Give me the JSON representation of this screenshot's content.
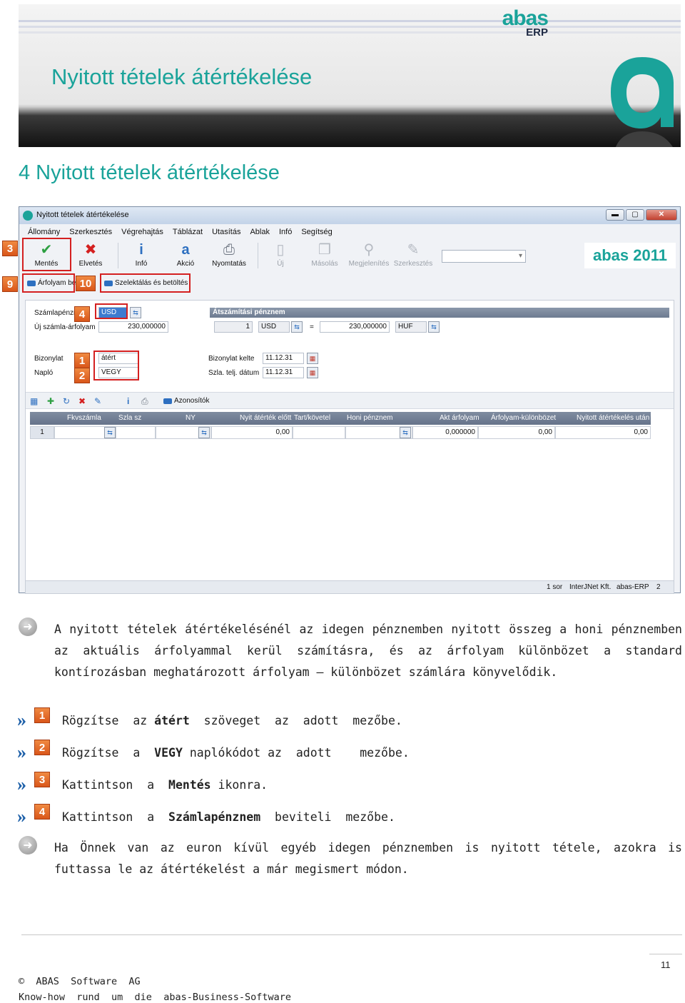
{
  "banner": {
    "title": "Nyitott tételek átértékelése",
    "logo_line1": "abas",
    "logo_line2": "ERP"
  },
  "heading": "4 Nyitott tételek átértékelése",
  "window": {
    "title": "Nyitott tételek átértékelése",
    "menu": [
      "Állomány",
      "Szerkesztés",
      "Végrehajtás",
      "Táblázat",
      "Utasítás",
      "Ablak",
      "Infó",
      "Segítség"
    ],
    "toolbar": {
      "mentes": "Mentés",
      "elvetes": "Elvetés",
      "info": "Infó",
      "akcio": "Akció",
      "nyomtatas": "Nyomtatás",
      "uj": "Új",
      "masolas": "Másolás",
      "megjelenites": "Megjelenítés",
      "szerkesztes": "Szerkesztés"
    },
    "version_label": "abas 2011",
    "subbar": {
      "arfolyam": "Árfolyam bet",
      "szelektalas": "Szelektálás és betöltés"
    },
    "form": {
      "szamlapenznem_label": "Számlapénzn",
      "szamlapenznem_value": "USD",
      "uj_arfolyam_label": "Új számla-árfolyam",
      "uj_arfolyam_value": "230,000000",
      "section_title": "Átszámítási pénznem",
      "conv_qty": "1",
      "conv_from": "USD",
      "conv_eq": "=",
      "conv_rate": "230,000000",
      "conv_to": "HUF",
      "bizonylat_label": "Bizonylat",
      "bizonylat_value": "átért",
      "naplo_label": "Napló",
      "naplo_value": "VEGY",
      "bizonylat_kelte_label": "Bizonylat kelte",
      "bizonylat_kelte_value": "11.12.31",
      "szla_telj_label": "Szla. telj. dátum",
      "szla_telj_value": "11.12.31"
    },
    "grid_toolbar_label": "Azonosítók",
    "grid_headers": [
      "Fkvszámla",
      "Szla sz",
      "NY",
      "Nyit átérték előtt",
      "Tart/követel",
      "Honi pénznem",
      "Akt árfolyam",
      "Árfolyam-különbözet",
      "Nyitott átértékelés után"
    ],
    "grid_row": {
      "num": "1",
      "nyit_elott": "0,00",
      "akt_arfolyam": "0,000000",
      "kulonbozet": "0,00",
      "utan": "0,00"
    },
    "status": {
      "rows": "1 sor",
      "company": "InterJNet Kft.",
      "app": "abas-ERP",
      "num": "2"
    }
  },
  "markers": [
    "3",
    "9",
    "10",
    "4",
    "1",
    "2"
  ],
  "paragraph1": "A nyitott tételek átértékelésénél az idegen pénznemben nyitott összeg a honi pénznemben az aktuális árfolyammal kerül számításra, és az árfolyam különbözet a standard kontírozásban meghatározott árfolyam – különbözet számlára könyvelődik.",
  "steps": [
    {
      "num": "1",
      "pre": "Rögzítse  az ",
      "bold": "átért",
      "post": "  szöveget  az  adott  mezőbe."
    },
    {
      "num": "2",
      "pre": "Rögzítse  a  ",
      "bold": "VEGY",
      "post": " naplókódot az  adott    mezőbe."
    },
    {
      "num": "3",
      "pre": "Kattintson  a  ",
      "bold": "Mentés",
      "post": " ikonra."
    },
    {
      "num": "4",
      "pre": "Kattintson  a  ",
      "bold": "Számlapénznem",
      "post": "  beviteli  mezőbe."
    }
  ],
  "paragraph2": "Ha Önnek van az euron kívül egyéb idegen pénznemben is nyitott tétele, azokra is futtassa le az átértékelést a már megismert módon.",
  "page_number": "11",
  "footer": {
    "line1": "©  ABAS  Software  AG",
    "line2": "Know-how  rund  um  die  abas-Business-Software"
  }
}
